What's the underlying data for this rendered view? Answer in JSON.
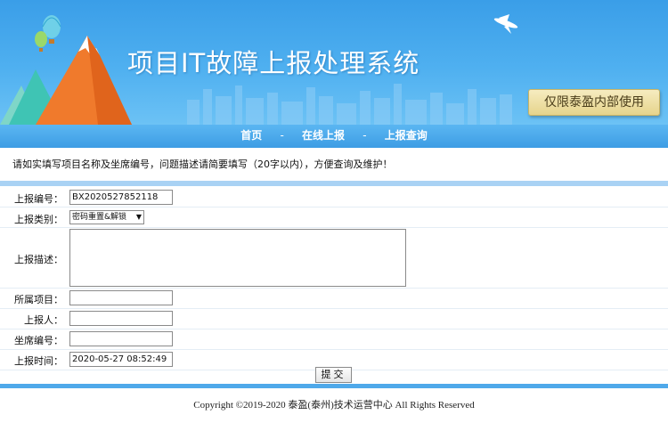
{
  "header": {
    "title": "项目IT故障上报处理系统",
    "badge": "仅限泰盈内部使用"
  },
  "nav": {
    "items": [
      "首页",
      "在线上报",
      "上报查询"
    ],
    "separator": "-"
  },
  "notice": "请如实填写项目名称及坐席编号，问题描述请简要填写（20字以内），方便查询及维护！",
  "form": {
    "report_no": {
      "label": "上报编号：",
      "value": "BX2020527852118"
    },
    "report_type": {
      "label": "上报类别：",
      "value": "密码重置&解锁"
    },
    "description": {
      "label": "上报描述：",
      "value": ""
    },
    "project": {
      "label": "所属项目：",
      "value": ""
    },
    "reporter": {
      "label": "上报人：",
      "value": ""
    },
    "seat_no": {
      "label": "坐席编号：",
      "value": ""
    },
    "report_time": {
      "label": "上报时间：",
      "value": "2020-05-27 08:52:49"
    },
    "submit_label": "提交"
  },
  "footer": "Copyright ©2019-2020 泰盈(泰州)技术运营中心 All Rights Reserved",
  "colors": {
    "banner": "#4fb0f0",
    "nav": "#3d9de4",
    "accent_bar": "#a9d2f4"
  }
}
